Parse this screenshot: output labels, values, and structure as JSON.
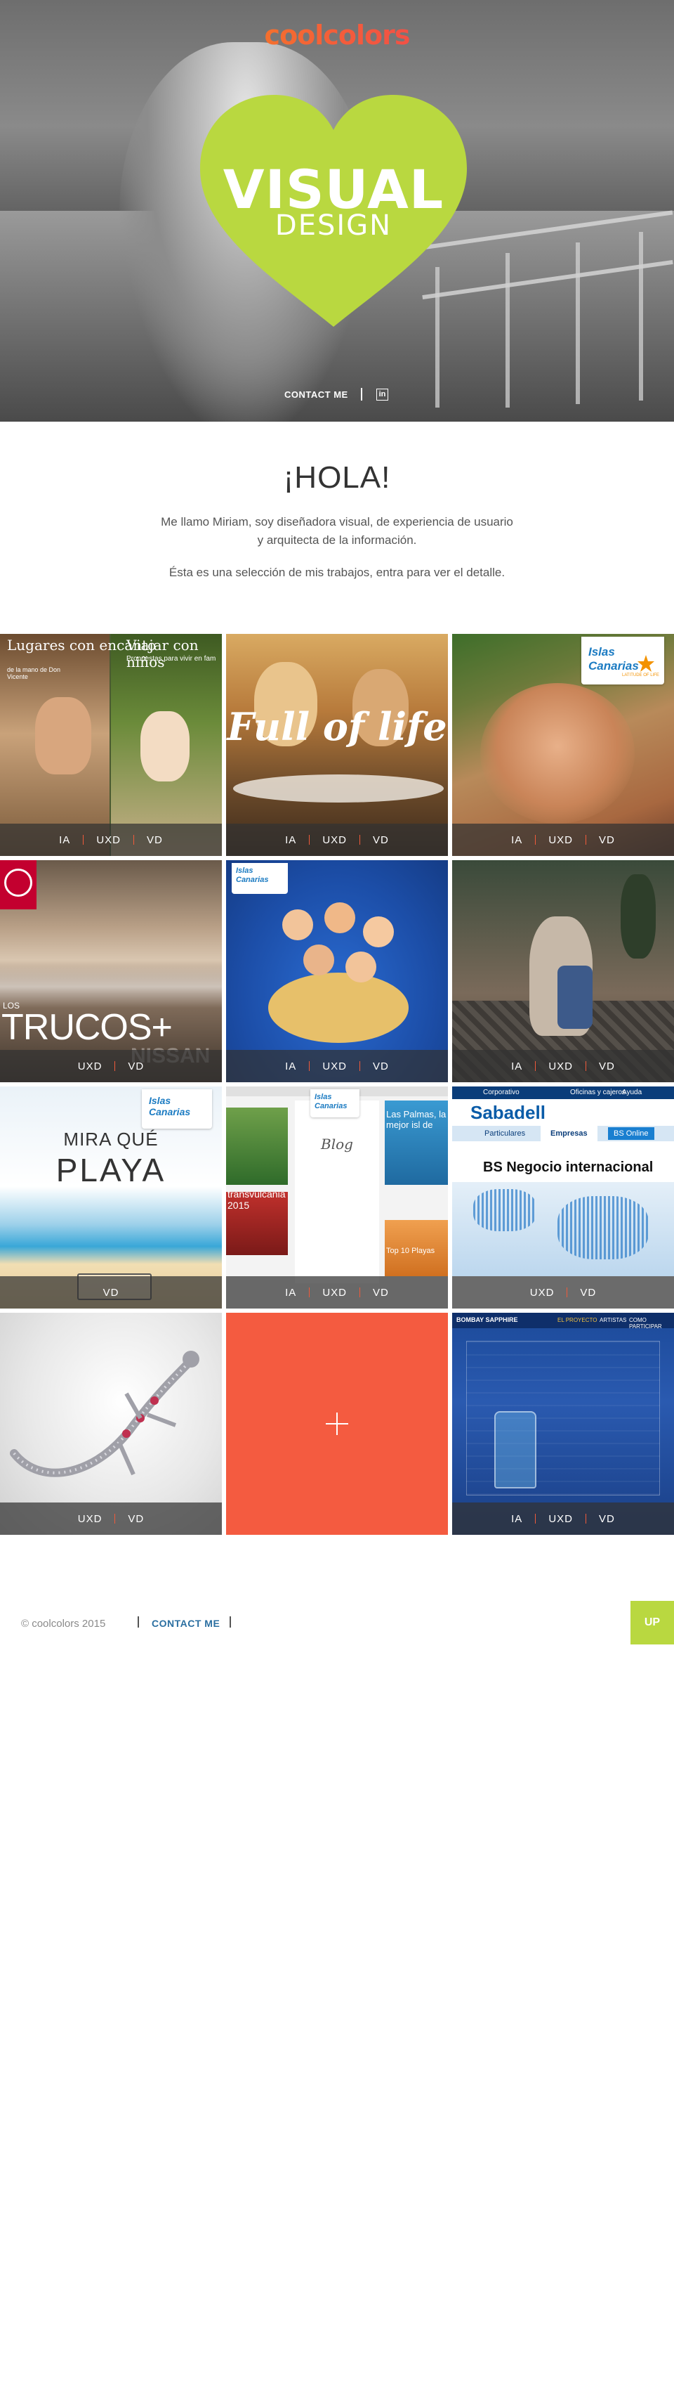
{
  "header": {
    "logo": "coolcolors",
    "heart_title": "VISUAL",
    "heart_subtitle": "DESIGN",
    "contact_label": "CONTACT ME",
    "linkedin_glyph": "in"
  },
  "intro": {
    "title": "¡HOLA!",
    "line1": "Me llamo Miriam, soy diseñadora visual, de experiencia de usuario",
    "line2": "y arquitecta de la información.",
    "line3": "Ésta es una selección de mis trabajos, entra para ver el detalle."
  },
  "tiles": [
    {
      "name": "lugares-con-encanto",
      "tags": [
        "IA",
        "UXD",
        "VD"
      ],
      "text1": "Lugares con encanto",
      "text2": "Viajar con niños",
      "text3": "de la mano de Don Vicente",
      "text4": "Propuestas para vivir en fam"
    },
    {
      "name": "full-of-life",
      "tags": [
        "IA",
        "UXD",
        "VD"
      ],
      "text1": "Full of life"
    },
    {
      "name": "islas-canarias-sun",
      "tags": [
        "IA",
        "UXD",
        "VD"
      ]
    },
    {
      "name": "nissan-trucos",
      "tags": [
        "UXD",
        "VD"
      ],
      "text1": "LOS",
      "text2": "TRUCOS+",
      "text3": "NISSAN"
    },
    {
      "name": "islas-canarias-kids",
      "tags": [
        "IA",
        "UXD",
        "VD"
      ]
    },
    {
      "name": "lanzarote-couple",
      "tags": [
        "IA",
        "UXD",
        "VD"
      ]
    },
    {
      "name": "mira-que-playa",
      "tags": [
        "VD"
      ],
      "text1": "MIRA QUÉ",
      "text2": "PLAYA"
    },
    {
      "name": "islas-canarias-blog",
      "tags": [
        "IA",
        "UXD",
        "VD"
      ],
      "text1": "Blog",
      "text2": "Las Palmas, la mejor isl de",
      "text3": "transvulcania 2015",
      "text4": "Top 10 Playas"
    },
    {
      "name": "sabadell",
      "tags": [
        "UXD",
        "VD"
      ],
      "text1": "Sabadell",
      "text2": "BS Negocio internacional",
      "nav1": "Particulares",
      "nav2": "Empresas",
      "nav3": "BS Online",
      "top1": "Corporativo",
      "top2": "Oficinas y cajeros",
      "top3": "Ayuda"
    },
    {
      "name": "gecko-jewel",
      "tags": [
        "UXD",
        "VD"
      ]
    },
    {
      "name": "more-projects",
      "tags": []
    },
    {
      "name": "bombay-sapphire",
      "tags": [
        "IA",
        "UXD",
        "VD"
      ],
      "text1": "BOMBAY SAPPHIRE",
      "text2": "EL PROYECTO",
      "text3": "ARTISTAS",
      "text4": "COMO PARTICIPAR"
    }
  ],
  "islas_canarias": {
    "line1": "Islas",
    "line2": "Canarias",
    "tagline": "LATITUDE OF LIFE"
  },
  "footer": {
    "copyright": "© coolcolors 2015",
    "contact_label": "CONTACT ME",
    "up_label": "UP"
  },
  "colors": {
    "accent_green": "#b9d840",
    "coral": "#f45b40",
    "link_blue": "#2b6fa1"
  }
}
